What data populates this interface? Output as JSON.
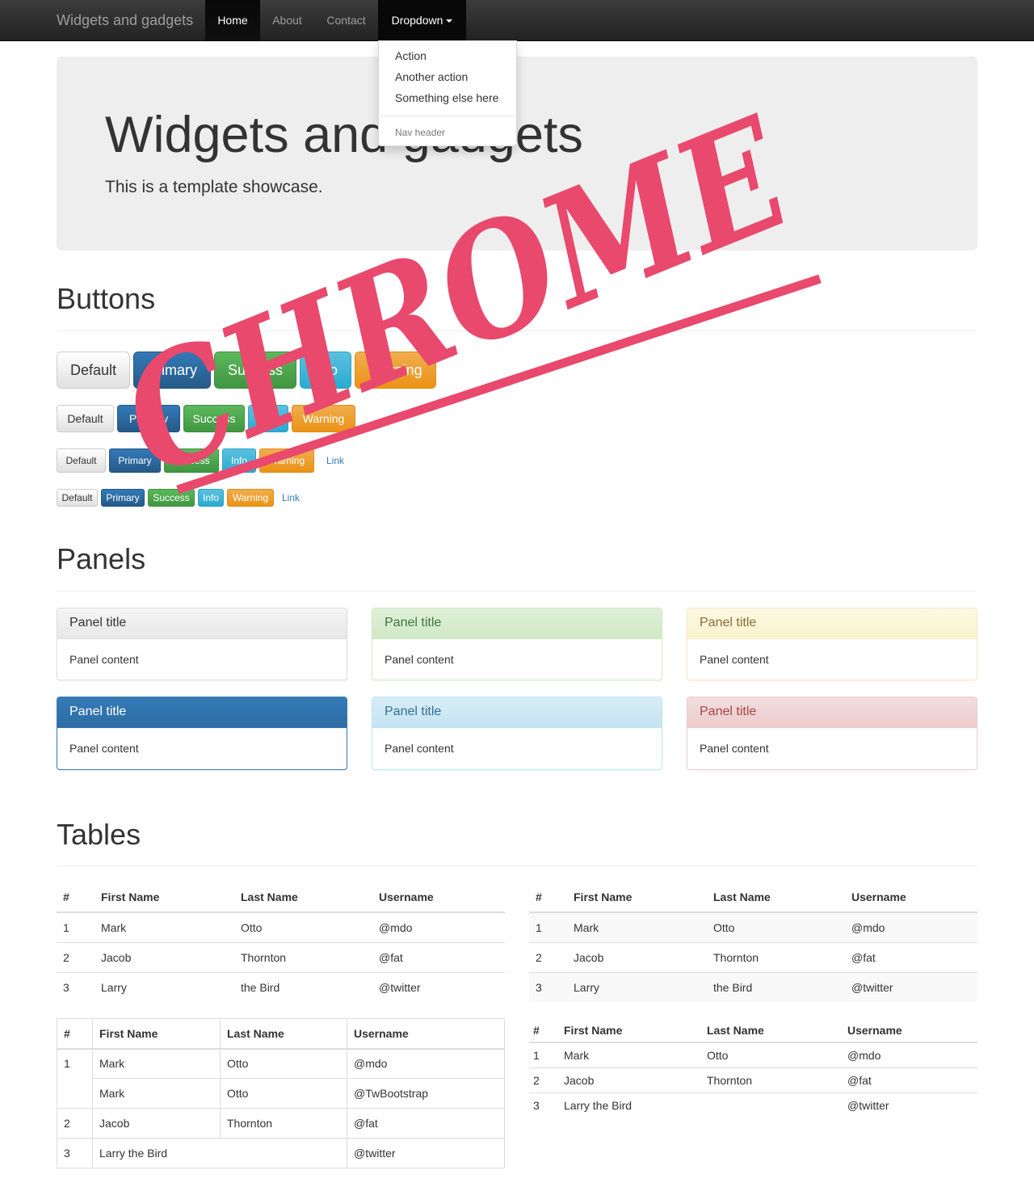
{
  "navbar": {
    "brand": "Widgets and gadgets",
    "items": [
      {
        "label": "Home"
      },
      {
        "label": "About"
      },
      {
        "label": "Contact"
      },
      {
        "label": "Dropdown"
      }
    ],
    "dropdown": {
      "items": [
        "Action",
        "Another action",
        "Something else here"
      ],
      "header": "Nav header"
    }
  },
  "jumbotron": {
    "title": "Widgets and gadgets",
    "text": "This is a template showcase."
  },
  "sections": {
    "buttons": "Buttons",
    "panels": "Panels",
    "tables": "Tables"
  },
  "buttons": {
    "default": "Default",
    "primary": "Primary",
    "success": "Success",
    "info": "Info",
    "warning": "Warning",
    "link": "Link"
  },
  "panels": {
    "title": "Panel title",
    "content": "Panel content"
  },
  "tables": {
    "headers": [
      "#",
      "First Name",
      "Last Name",
      "Username"
    ],
    "rows": [
      [
        "1",
        "Mark",
        "Otto",
        "@mdo"
      ],
      [
        "2",
        "Jacob",
        "Thornton",
        "@fat"
      ],
      [
        "3",
        "Larry",
        "the Bird",
        "@twitter"
      ]
    ],
    "bordered_rows": [
      [
        "1",
        "Mark",
        "Otto",
        "@mdo"
      ],
      [
        "",
        "Mark",
        "Otto",
        "@TwBootstrap"
      ],
      [
        "2",
        "Jacob",
        "Thornton",
        "@fat"
      ],
      [
        "3",
        "Larry the Bird",
        "",
        "@twitter"
      ]
    ],
    "condensed_rows": [
      [
        "1",
        "Mark",
        "Otto",
        "@mdo"
      ],
      [
        "2",
        "Jacob",
        "Thornton",
        "@fat"
      ],
      [
        "3",
        "Larry the Bird",
        "",
        "@twitter"
      ]
    ]
  },
  "watermark": {
    "text": "CHROME",
    "color": "#e8496d"
  },
  "colors": {
    "primary": "#337ab7",
    "success": "#5cb85c",
    "info": "#5bc0de",
    "warning": "#f0ad4e",
    "danger": "#a94442"
  }
}
